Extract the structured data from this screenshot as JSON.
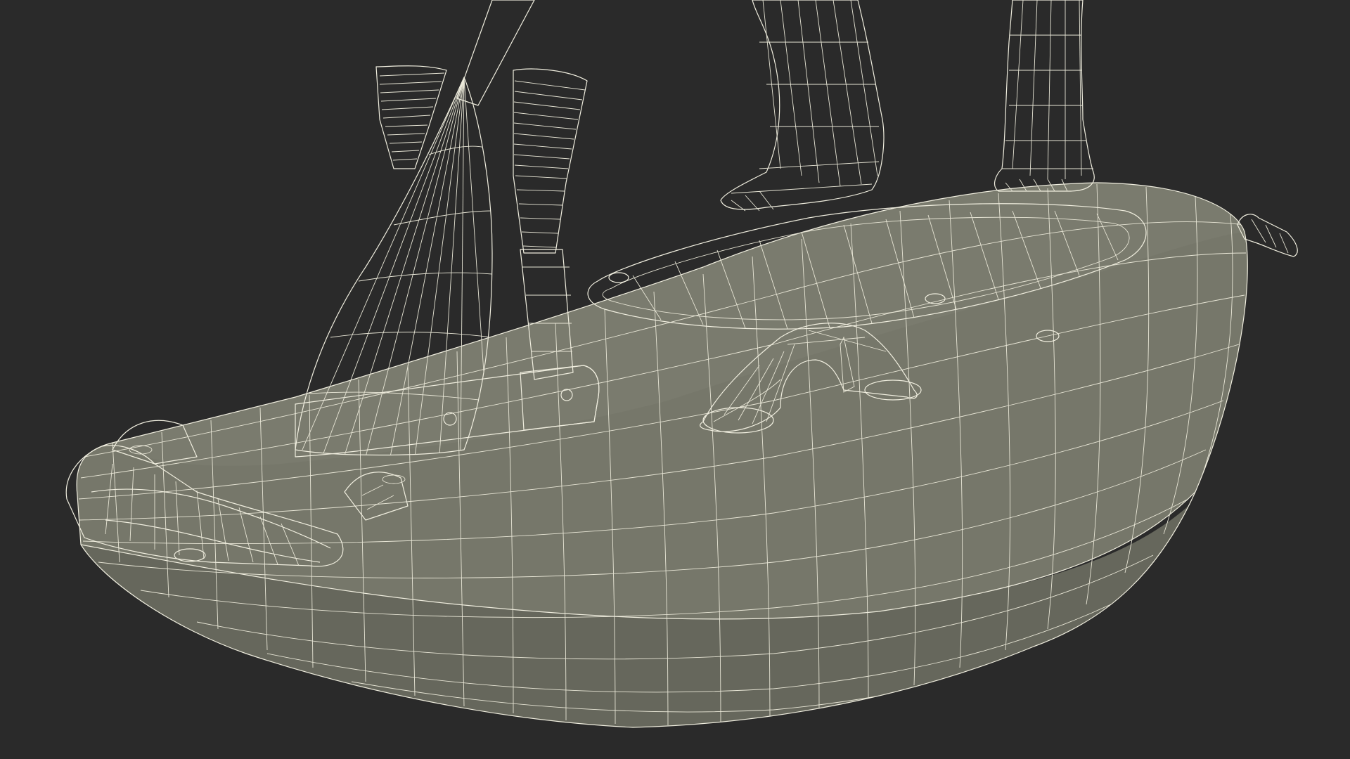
{
  "scene": {
    "background_color": "#2a2a2a",
    "surface_color": "#747568",
    "surface_dark_color": "#5c5d52",
    "surface_light_color": "#8a8b7e",
    "wire_color": "#f0eedf"
  }
}
